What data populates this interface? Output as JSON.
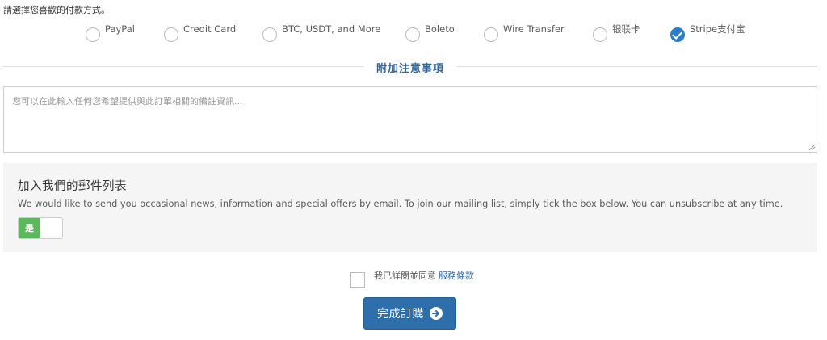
{
  "payment": {
    "prompt": "請選擇您喜歡的付款方式。",
    "options": [
      {
        "label": "PayPal",
        "checked": false
      },
      {
        "label": "Credit Card",
        "checked": false
      },
      {
        "label": "BTC, USDT, and More",
        "checked": false
      },
      {
        "label": "Boleto",
        "checked": false
      },
      {
        "label": "Wire Transfer",
        "checked": false
      },
      {
        "label": "银联卡",
        "checked": false
      },
      {
        "label": "Stripe支付宝",
        "checked": true
      }
    ]
  },
  "notes": {
    "section_title": "附加注意事項",
    "placeholder": "您可以在此輸入任何您希望提供與此訂單相關的備註資訊..."
  },
  "mailing": {
    "title": "加入我們的郵件列表",
    "description": "We would like to send you occasional news, information and special offers by email. To join our mailing list, simply tick the box below. You can unsubscribe at any time.",
    "toggle_label": "是",
    "toggle_on": true
  },
  "terms": {
    "agree_text": "我已詳閱並同意",
    "link_text": "服務條款",
    "checked": false
  },
  "order": {
    "button_label": "完成訂購",
    "icon": "arrow-circle-right-icon"
  },
  "colors": {
    "accent": "#2a7dc6",
    "button": "#2e6fab",
    "toggle_on": "#5cb85c",
    "link": "#336699"
  }
}
